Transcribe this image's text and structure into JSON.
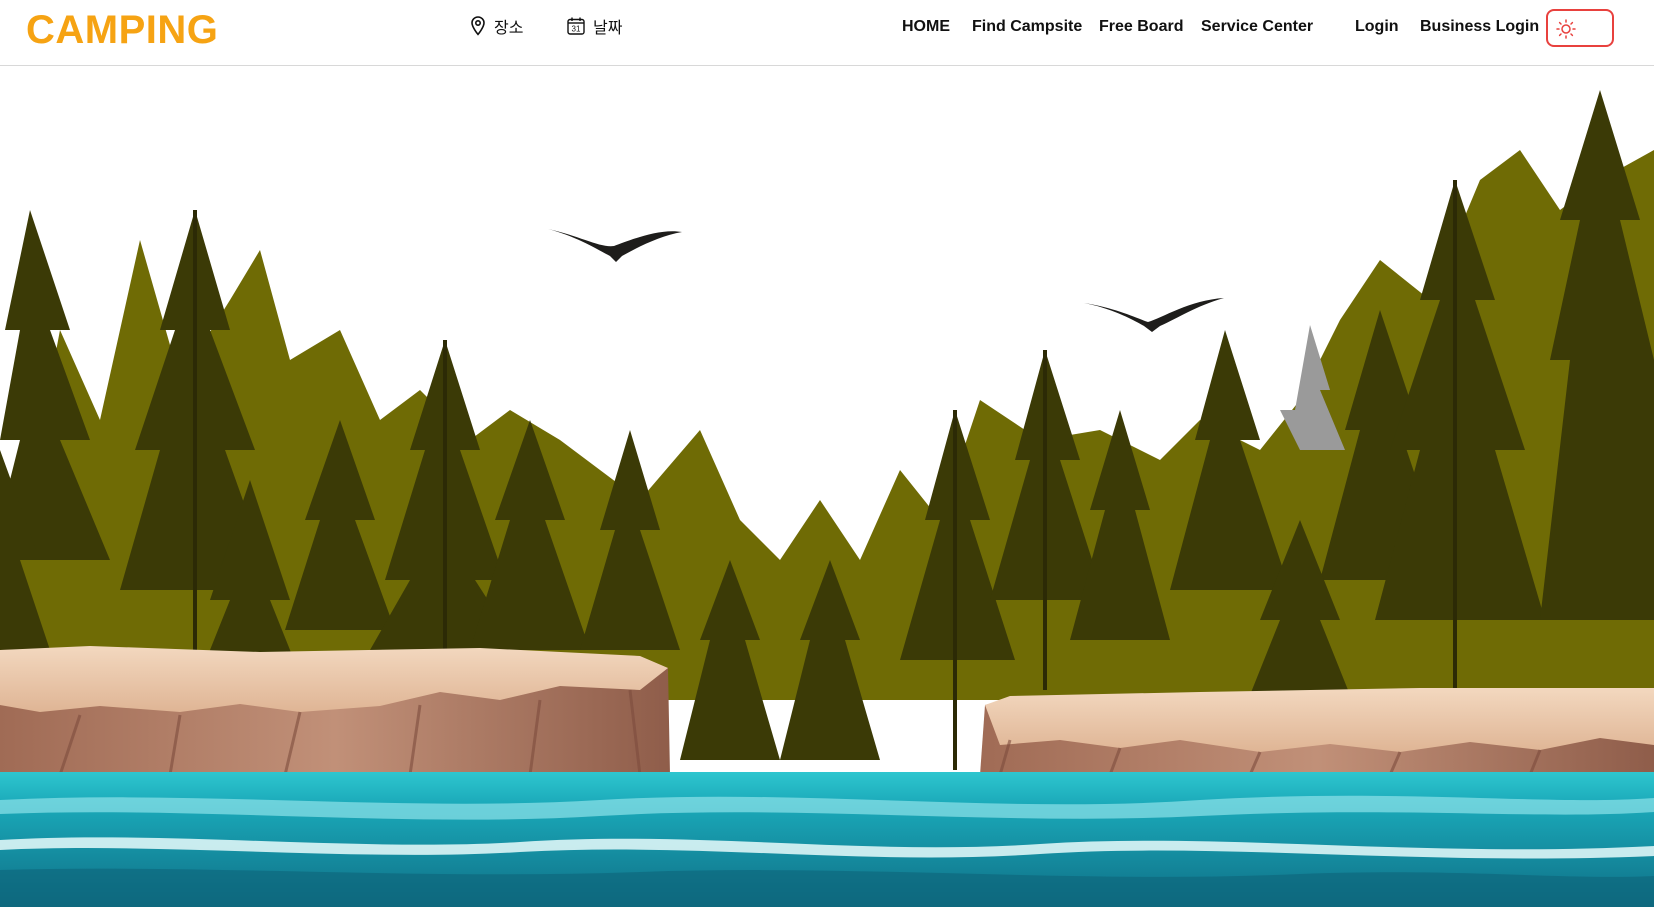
{
  "app": {
    "brand": "CAMPING"
  },
  "search": {
    "place_label": "장소",
    "place_icon": "map-pin-icon",
    "date_label": "날짜",
    "date_icon": "calendar-icon",
    "calendar_day": "31"
  },
  "nav": {
    "home": "HOME",
    "find_campsite": "Find Campsite",
    "free_board": "Free Board",
    "service_center": "Service Center",
    "login": "Login",
    "business_login": "Business Login"
  },
  "theme_toggle": {
    "icon": "sun-icon",
    "border_color": "#e8413e"
  },
  "colors": {
    "brand": "#f6a313",
    "forest_olive": "#6e6a06",
    "forest_dark": "#3a3a06",
    "cliff": "#b98670",
    "water": "#1fa9b8"
  }
}
